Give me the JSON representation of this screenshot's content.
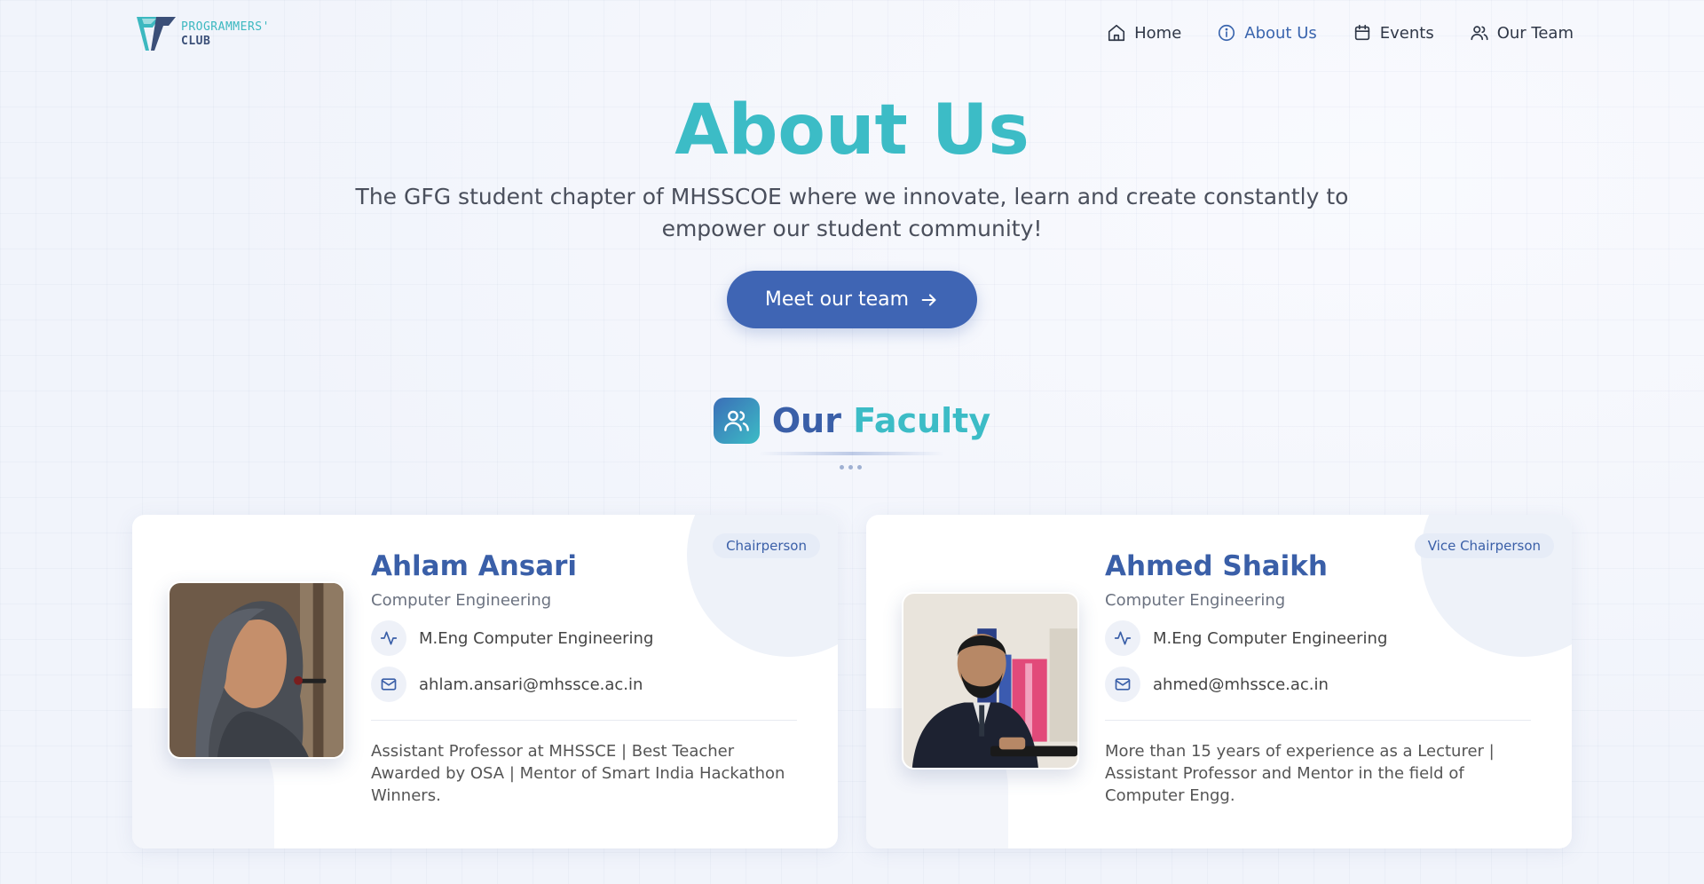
{
  "brand": {
    "line1": "PROGRAMMERS'",
    "line2": "CLUB"
  },
  "nav": [
    {
      "label": "Home",
      "icon": "home-icon"
    },
    {
      "label": "About Us",
      "icon": "info-icon",
      "active": true
    },
    {
      "label": "Events",
      "icon": "calendar-icon"
    },
    {
      "label": "Our Team",
      "icon": "users-icon"
    }
  ],
  "hero": {
    "title": "About Us",
    "subtitle": "The GFG student chapter of MHSSCOE where we innovate, learn and create constantly to empower our student community!",
    "cta_label": "Meet our team"
  },
  "section": {
    "title_part1": "Our",
    "title_part2": "Faculty"
  },
  "faculty": [
    {
      "badge": "Chairperson",
      "name": "Ahlam Ansari",
      "department": "Computer Engineering",
      "qualification": "M.Eng Computer Engineering",
      "email": "ahlam.ansari@mhssce.ac.in",
      "bio": "Assistant Professor at MHSSCE | Best Teacher Awarded by OSA | Mentor of Smart India Hackathon Winners."
    },
    {
      "badge": "Vice Chairperson",
      "name": "Ahmed Shaikh",
      "department": "Computer Engineering",
      "qualification": "M.Eng Computer Engineering",
      "email": "ahmed@mhssce.ac.in",
      "bio": "More than 15 years of experience as a Lecturer | Assistant Professor and Mentor in the field of Computer Engg."
    }
  ],
  "colors": {
    "primary": "#3f65b4",
    "accent": "#3cbcc6",
    "text": "#2f3747"
  }
}
